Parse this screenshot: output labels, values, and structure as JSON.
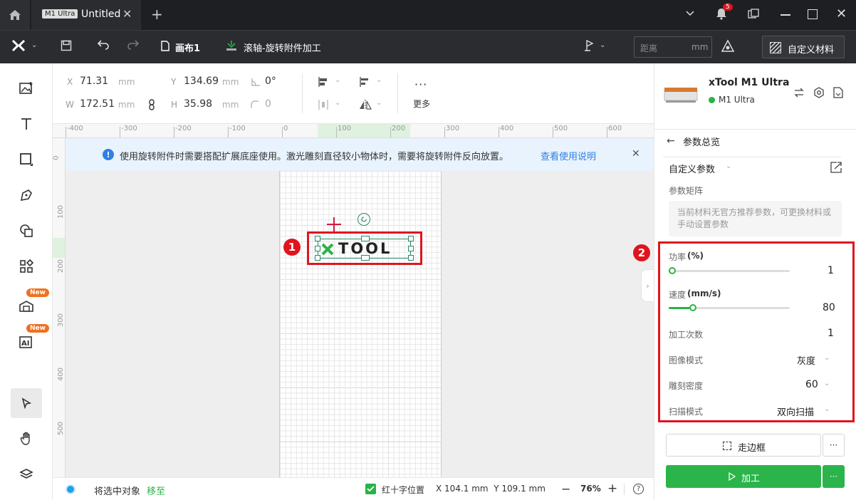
{
  "titlebar": {
    "tab_badge": "M1 Ultra",
    "tab_title": "Untitled",
    "notif_count": "5"
  },
  "toolbar": {
    "canvas_name": "画布1",
    "mode_name": "滚轴-旋转附件加工",
    "distance_placeholder": "距离",
    "distance_unit": "mm",
    "custom_material": "自定义材料"
  },
  "leftbar": {
    "new_badge_1": "New",
    "new_badge_2": "New"
  },
  "props": {
    "x_label": "X",
    "x_value": "71.31",
    "x_unit": "mm",
    "y_label": "Y",
    "y_value": "134.69",
    "y_unit": "mm",
    "angle_value": "0°",
    "w_label": "W",
    "w_value": "172.51",
    "w_unit": "mm",
    "h_label": "H",
    "h_value": "35.98",
    "h_unit": "mm",
    "radius_value": "0",
    "more_label": "更多"
  },
  "ruler": {
    "h_ticks": [
      "-400",
      "-300",
      "-200",
      "-100",
      "0",
      "100",
      "200",
      "300",
      "400",
      "500",
      "600"
    ],
    "v_ticks": [
      "0",
      "100",
      "200",
      "300",
      "400",
      "500"
    ]
  },
  "notice": {
    "text": "使用旋转附件时需要搭配扩展底座使用。激光雕刻直径较小物体时，需要将旋转附件反向放置。",
    "link": "查看使用说明"
  },
  "canvas": {
    "logo_text": "TOOL",
    "logo_x": "X",
    "marker1": "1",
    "marker2": "2"
  },
  "status": {
    "move_prefix": "将选中对象",
    "move_link": "移至",
    "crosshair_label": "红十字位置",
    "coords": "X 104.1 mm  Y 109.1 mm",
    "zoom": "76%"
  },
  "device": {
    "name": "xTool M1 Ultra",
    "model": "M1 Ultra",
    "status_color": "#28b446"
  },
  "panel": {
    "back_title": "参数总览",
    "custom_params": "自定义参数",
    "matrix_title": "参数矩阵",
    "matrix_note": "当前材料无官方推荐参数，可更换材料或手动设置参数",
    "power_label": "功率",
    "power_unit": "(%)",
    "power_value": "1",
    "power_fraction": 0.01,
    "speed_label": "速度",
    "speed_unit": "(mm/s)",
    "speed_value": "80",
    "speed_fraction": 0.2,
    "passes_label": "加工次数",
    "passes_value": "1",
    "image_mode_label": "图像模式",
    "image_mode_value": "灰度",
    "density_label": "雕刻密度",
    "density_value": "60",
    "scan_label": "扫描模式",
    "scan_value": "双向扫描",
    "frame_button": "走边框",
    "process_button": "加工"
  }
}
